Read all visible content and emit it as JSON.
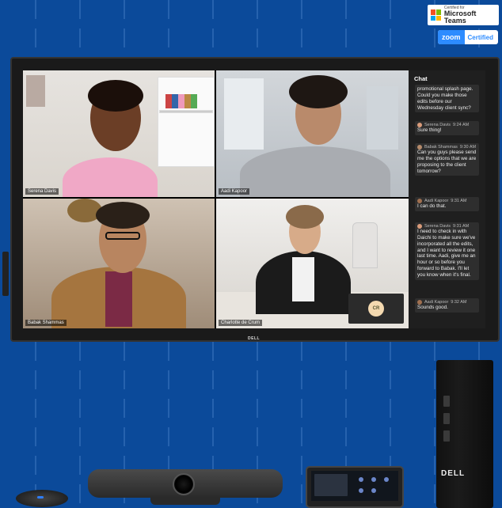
{
  "badges": {
    "teams_small": "Certified for",
    "teams_big": "Microsoft Teams",
    "zoom_word": "zoom",
    "zoom_cert": "Certified"
  },
  "meeting": {
    "participants": [
      {
        "name": "Serena Davis"
      },
      {
        "name": "Aadi Kapoor"
      },
      {
        "name": "Babak Shammas"
      },
      {
        "name": "Charlotte de Crum"
      }
    ],
    "self_view_initials": "CR"
  },
  "chat": {
    "title": "Chat",
    "messages": [
      {
        "author": "",
        "time": "",
        "text": "promotional splash page. Could you make those edits before our Wednesday client sync?"
      },
      {
        "author": "Serena Davis",
        "time": "9:24 AM",
        "text": "Sure thing!"
      },
      {
        "author": "Babak Shammas",
        "time": "9:30 AM",
        "text": "Can you guys please send me the options that we are proposing to the client tomorrow?"
      },
      {
        "author": "Aadi Kapoor",
        "time": "9:31 AM",
        "text": "I can do that."
      },
      {
        "author": "Serena Davis",
        "time": "9:31 AM",
        "text": "I need to check in with Daichi to make sure we've incorporated all the edits, and I want to review it one last time. Aadi, give me an hour or so before you forward to Babak. I'll let you know when it's final."
      },
      {
        "author": "Aadi Kapoor",
        "time": "9:32 AM",
        "text": "Sounds good."
      }
    ]
  },
  "brand": {
    "monitor_logo": "DELL",
    "pc_logo": "DELL"
  },
  "colors": {
    "background": "#0b4a9a",
    "zoom_blue": "#2d8cff",
    "chat_bg": "#1f1f1f"
  }
}
